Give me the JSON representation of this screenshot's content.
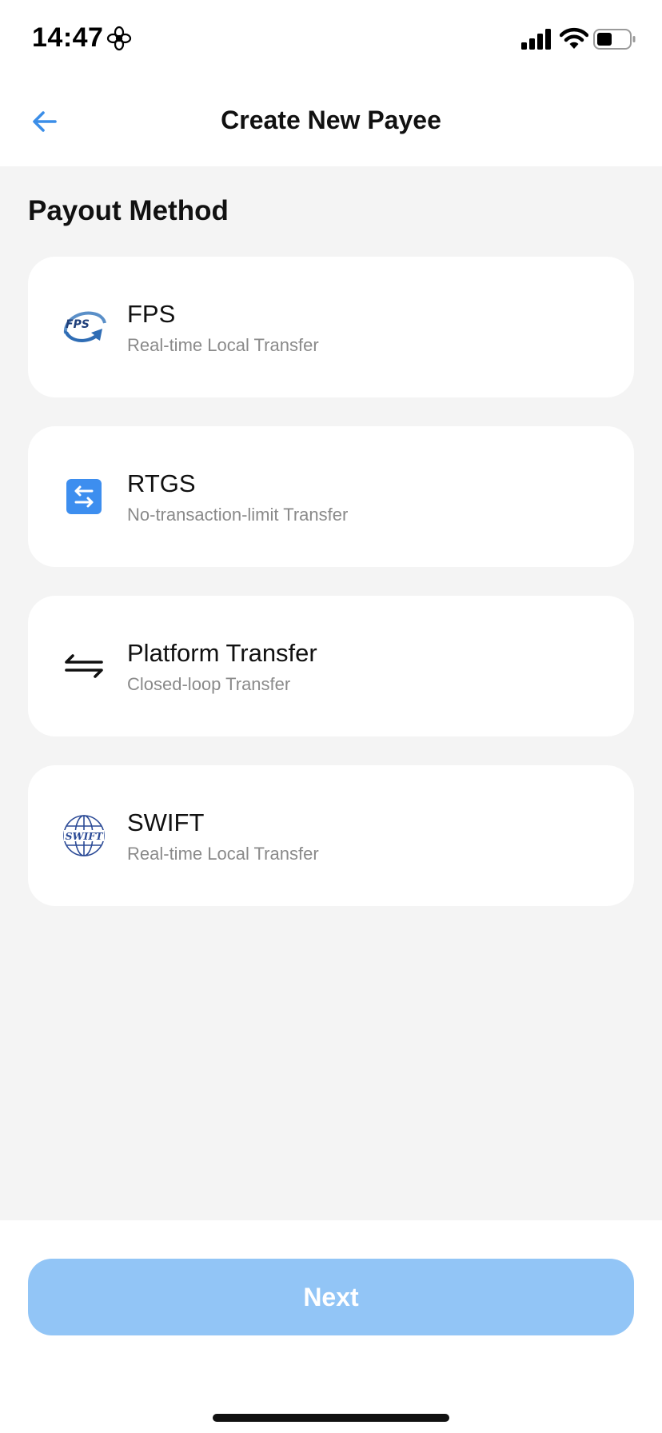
{
  "status_bar": {
    "time": "14:47",
    "focus_icon": "flower-icon",
    "signal_icon": "cellular-signal-icon",
    "wifi_icon": "wifi-icon",
    "battery_icon": "battery-icon"
  },
  "nav": {
    "back_icon": "arrow-left-icon",
    "title": "Create New Payee"
  },
  "section_title": "Payout Method",
  "methods": [
    {
      "name": "FPS",
      "description": "Real-time Local Transfer",
      "icon": "fps-logo-icon",
      "logo_text": "FPS"
    },
    {
      "name": "RTGS",
      "description": "No-transaction-limit Transfer",
      "icon": "swap-arrows-icon"
    },
    {
      "name": "Platform Transfer",
      "description": "Closed-loop Transfer",
      "icon": "transfer-arrows-icon"
    },
    {
      "name": "SWIFT",
      "description": "Real-time Local Transfer",
      "icon": "swift-globe-icon",
      "logo_text": "SWIFT"
    }
  ],
  "footer": {
    "next_label": "Next",
    "next_enabled": false
  },
  "colors": {
    "accent": "#3b8ee8",
    "next_button_disabled": "#92c5f6",
    "background": "#f4f4f4",
    "card": "#ffffff",
    "secondary_text": "#8a8a8a"
  }
}
